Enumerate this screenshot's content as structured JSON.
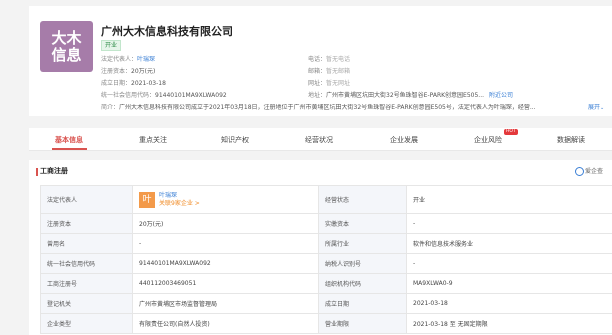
{
  "company": {
    "logo_text": "大木信息",
    "name": "广州大木信息科技有限公司",
    "status_badge": "开业",
    "legal_rep_label": "法定代表人：",
    "legal_rep": "叶瑞琛",
    "capital_label": "注册资本：",
    "capital": "20万(元)",
    "founded_label": "成立日期：",
    "founded": "2021-03-18",
    "credit_label": "统一社会信用代码：",
    "credit": "91440101MA9XLWA092",
    "phone_label": "电话：",
    "phone": "暂无电话",
    "email_label": "邮箱：",
    "email": "暂无邮箱",
    "website_label": "网址：",
    "website": "暂无网址",
    "address_label": "地址：",
    "address": "广州市黄埔区坑田大街32号鱼珠智谷E-PARK创意园E505...",
    "nearby": "附近公司",
    "intro_label": "简介：",
    "intro": "广州大木信息科技有限公司成立于2021年03月18日，注册地位于广州市黄埔区坑田大街32号鱼珠智谷E-PARK创意园E505号，法定代表人为叶瑞琛，经营...",
    "expand": "展开"
  },
  "tabs": [
    {
      "label": "基本信息",
      "active": true
    },
    {
      "label": "重点关注"
    },
    {
      "label": "知识产权"
    },
    {
      "label": "经营状况"
    },
    {
      "label": "企业发展"
    },
    {
      "label": "企业风险",
      "hot": "HOT"
    },
    {
      "label": "数据解读"
    }
  ],
  "section": {
    "title": "工商注册",
    "source": "爱企查"
  },
  "registration": {
    "legal_rep_key": "法定代表人",
    "avatar_char": "叶",
    "legal_rep_name": "叶瑞琛",
    "legal_rep_related": "关联9家企业 >",
    "rows": [
      {
        "k1": "经营状态",
        "v1": "开业"
      },
      {
        "k0": "注册资本",
        "v0": "20万(元)",
        "k1": "实缴资本",
        "v1": "-"
      },
      {
        "k0": "曾用名",
        "v0": "-",
        "k1": "所属行业",
        "v1": "软件和信息技术服务业"
      },
      {
        "k0": "统一社会信用代码",
        "v0": "91440101MA9XLWA092",
        "k1": "纳税人识别号",
        "v1": "-"
      },
      {
        "k0": "工商注册号",
        "v0": "440112003469051",
        "k1": "组织机构代码",
        "v1": "MA9XLWA0-9"
      },
      {
        "k0": "登记机关",
        "v0": "广州市黄埔区市场监督管理局",
        "k1": "成立日期",
        "v1": "2021-03-18"
      },
      {
        "k0": "企业类型",
        "v0": "有限责任公司(自然人投资)",
        "k1": "营业期限",
        "v1": "2021-03-18 至 无固定期限"
      }
    ]
  },
  "colors": {
    "accent": "#d9534f",
    "link": "#3a7fd5",
    "logo_bg": "#a67ca9",
    "avatar_bg": "#f39a4a"
  }
}
